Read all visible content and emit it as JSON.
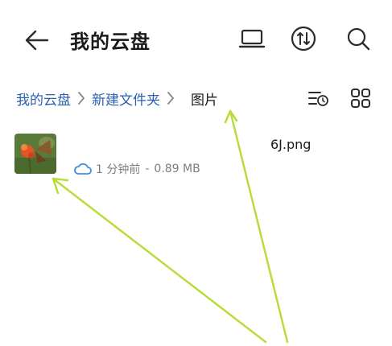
{
  "header": {
    "title": "我的云盘",
    "back_icon": "arrow-left-icon",
    "actions": [
      "laptop-icon",
      "transfer-icon",
      "search-icon"
    ]
  },
  "breadcrumb": {
    "items": [
      "我的云盘",
      "新建文件夹"
    ],
    "current": "图片"
  },
  "toolbar": {
    "sort_icon": "sort-time-icon",
    "view_icon": "grid-view-icon"
  },
  "file": {
    "name": "6J.png",
    "time": "1 分钟前",
    "separator": "-",
    "size": "0.89 MB",
    "status_icon": "cloud-icon"
  },
  "annotation": {
    "color": "#b8dd3a"
  }
}
